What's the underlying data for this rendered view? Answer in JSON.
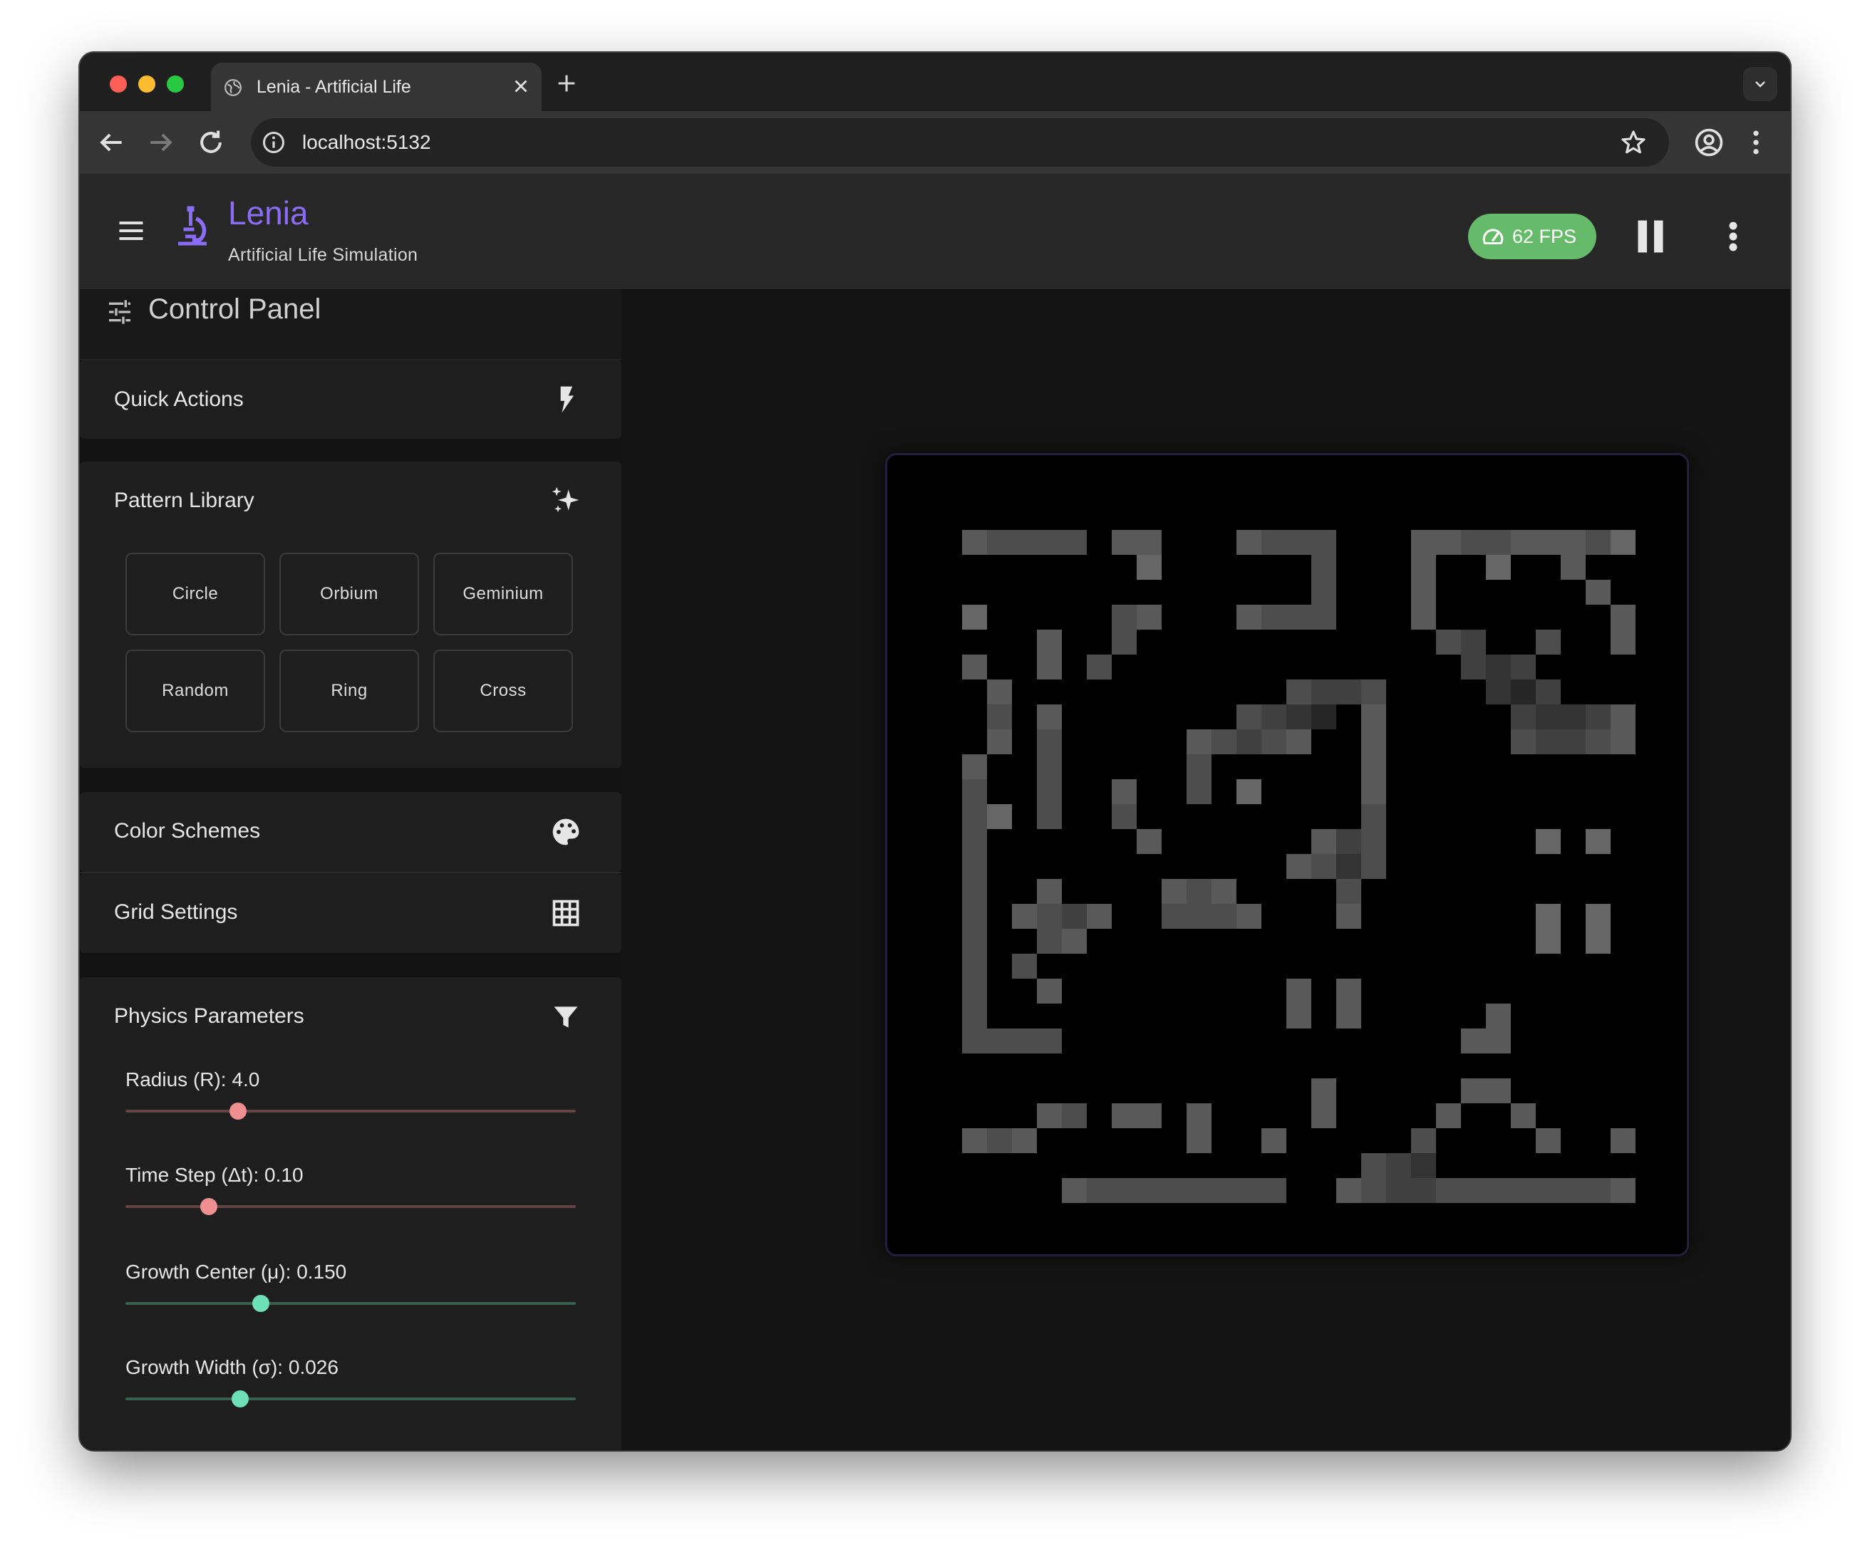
{
  "browser": {
    "tab_title": "Lenia - Artificial Life",
    "url": "localhost:5132"
  },
  "app": {
    "title": "Lenia",
    "subtitle": "Artificial Life Simulation",
    "fps_label": "62 FPS",
    "accent_color": "#8b6cf6",
    "fps_color": "#66bb6a"
  },
  "sidebar": {
    "title": "Control Panel",
    "sections": {
      "quick_actions": "Quick Actions",
      "pattern_library": "Pattern Library",
      "color_schemes": "Color Schemes",
      "grid_settings": "Grid Settings",
      "physics_parameters": "Physics Parameters"
    },
    "patterns": [
      "Circle",
      "Orbium",
      "Geminium",
      "Random",
      "Ring",
      "Cross"
    ],
    "params": [
      {
        "label": "Radius (R): 4.0",
        "fraction": 0.25,
        "color": "#ef8f8f"
      },
      {
        "label": "Time Step (Δt): 0.10",
        "fraction": 0.185,
        "color": "#ef8f8f"
      },
      {
        "label": "Growth Center (μ): 0.150",
        "fraction": 0.3,
        "color": "#6ee0b8"
      },
      {
        "label": "Growth Width (σ): 0.026",
        "fraction": 0.255,
        "color": "#6ee0b8"
      }
    ]
  },
  "simulation": {
    "grid_size": 27,
    "cells": [
      [
        3,
        3,
        0.35
      ],
      [
        4,
        3,
        0.3
      ],
      [
        5,
        3,
        0.3
      ],
      [
        6,
        3,
        0.3
      ],
      [
        7,
        3,
        0.3
      ],
      [
        9,
        3,
        0.35
      ],
      [
        10,
        3,
        0.35
      ],
      [
        14,
        3,
        0.35
      ],
      [
        15,
        3,
        0.3
      ],
      [
        16,
        3,
        0.3
      ],
      [
        17,
        3,
        0.3
      ],
      [
        21,
        3,
        0.35
      ],
      [
        22,
        3,
        0.35
      ],
      [
        23,
        3,
        0.3
      ],
      [
        24,
        3,
        0.3
      ],
      [
        25,
        3,
        0.35
      ],
      [
        26,
        3,
        0.35
      ],
      [
        27,
        3,
        0.35
      ],
      [
        28,
        3,
        0.3
      ],
      [
        29,
        3,
        0.4
      ],
      [
        10,
        4,
        0.4
      ],
      [
        17,
        4,
        0.3
      ],
      [
        21,
        4,
        0.35
      ],
      [
        24,
        4,
        0.4
      ],
      [
        27,
        4,
        0.35
      ],
      [
        17,
        5,
        0.3
      ],
      [
        21,
        5,
        0.35
      ],
      [
        28,
        5,
        0.35
      ],
      [
        3,
        6,
        0.4
      ],
      [
        9,
        6,
        0.3
      ],
      [
        10,
        6,
        0.35
      ],
      [
        14,
        6,
        0.35
      ],
      [
        15,
        6,
        0.3
      ],
      [
        16,
        6,
        0.3
      ],
      [
        17,
        6,
        0.3
      ],
      [
        21,
        6,
        0.35
      ],
      [
        29,
        6,
        0.35
      ],
      [
        6,
        7,
        0.35
      ],
      [
        9,
        7,
        0.3
      ],
      [
        22,
        7,
        0.3
      ],
      [
        23,
        7,
        0.25
      ],
      [
        26,
        7,
        0.3
      ],
      [
        29,
        7,
        0.35
      ],
      [
        3,
        8,
        0.35
      ],
      [
        6,
        8,
        0.35
      ],
      [
        8,
        8,
        0.3
      ],
      [
        23,
        8,
        0.25
      ],
      [
        24,
        8,
        0.2
      ],
      [
        25,
        8,
        0.25
      ],
      [
        4,
        9,
        0.35
      ],
      [
        16,
        9,
        0.3
      ],
      [
        17,
        9,
        0.25
      ],
      [
        18,
        9,
        0.25
      ],
      [
        19,
        9,
        0.3
      ],
      [
        24,
        9,
        0.2
      ],
      [
        25,
        9,
        0.15
      ],
      [
        26,
        9,
        0.25
      ],
      [
        4,
        10,
        0.3
      ],
      [
        6,
        10,
        0.35
      ],
      [
        14,
        10,
        0.3
      ],
      [
        15,
        10,
        0.25
      ],
      [
        16,
        10,
        0.2
      ],
      [
        17,
        10,
        0.15
      ],
      [
        19,
        10,
        0.35
      ],
      [
        25,
        10,
        0.25
      ],
      [
        26,
        10,
        0.2
      ],
      [
        27,
        10,
        0.2
      ],
      [
        28,
        10,
        0.25
      ],
      [
        29,
        10,
        0.35
      ],
      [
        4,
        11,
        0.35
      ],
      [
        6,
        11,
        0.3
      ],
      [
        12,
        11,
        0.35
      ],
      [
        13,
        11,
        0.3
      ],
      [
        14,
        11,
        0.25
      ],
      [
        15,
        11,
        0.3
      ],
      [
        16,
        11,
        0.35
      ],
      [
        19,
        11,
        0.35
      ],
      [
        25,
        11,
        0.3
      ],
      [
        26,
        11,
        0.25
      ],
      [
        27,
        11,
        0.25
      ],
      [
        28,
        11,
        0.3
      ],
      [
        29,
        11,
        0.35
      ],
      [
        3,
        12,
        0.35
      ],
      [
        6,
        12,
        0.3
      ],
      [
        12,
        12,
        0.3
      ],
      [
        19,
        12,
        0.35
      ],
      [
        3,
        13,
        0.3
      ],
      [
        6,
        13,
        0.3
      ],
      [
        9,
        13,
        0.35
      ],
      [
        12,
        13,
        0.3
      ],
      [
        14,
        13,
        0.4
      ],
      [
        19,
        13,
        0.35
      ],
      [
        3,
        14,
        0.3
      ],
      [
        4,
        14,
        0.4
      ],
      [
        6,
        14,
        0.3
      ],
      [
        9,
        14,
        0.3
      ],
      [
        19,
        14,
        0.3
      ],
      [
        3,
        15,
        0.3
      ],
      [
        10,
        15,
        0.35
      ],
      [
        17,
        15,
        0.35
      ],
      [
        18,
        15,
        0.25
      ],
      [
        19,
        15,
        0.3
      ],
      [
        26,
        15,
        0.4
      ],
      [
        28,
        15,
        0.4
      ],
      [
        3,
        16,
        0.3
      ],
      [
        16,
        16,
        0.35
      ],
      [
        17,
        16,
        0.3
      ],
      [
        18,
        16,
        0.2
      ],
      [
        19,
        16,
        0.3
      ],
      [
        3,
        17,
        0.3
      ],
      [
        6,
        17,
        0.35
      ],
      [
        11,
        17,
        0.35
      ],
      [
        12,
        17,
        0.3
      ],
      [
        13,
        17,
        0.35
      ],
      [
        18,
        17,
        0.3
      ],
      [
        3,
        18,
        0.3
      ],
      [
        5,
        18,
        0.35
      ],
      [
        6,
        18,
        0.3
      ],
      [
        7,
        18,
        0.25
      ],
      [
        8,
        18,
        0.35
      ],
      [
        11,
        18,
        0.3
      ],
      [
        12,
        18,
        0.3
      ],
      [
        13,
        18,
        0.3
      ],
      [
        14,
        18,
        0.35
      ],
      [
        18,
        18,
        0.35
      ],
      [
        26,
        18,
        0.4
      ],
      [
        28,
        18,
        0.4
      ],
      [
        3,
        19,
        0.3
      ],
      [
        6,
        19,
        0.3
      ],
      [
        7,
        19,
        0.35
      ],
      [
        26,
        19,
        0.4
      ],
      [
        28,
        19,
        0.4
      ],
      [
        3,
        20,
        0.3
      ],
      [
        5,
        20,
        0.3
      ],
      [
        3,
        21,
        0.3
      ],
      [
        6,
        21,
        0.35
      ],
      [
        16,
        21,
        0.35
      ],
      [
        18,
        21,
        0.35
      ],
      [
        3,
        22,
        0.3
      ],
      [
        16,
        22,
        0.35
      ],
      [
        18,
        22,
        0.35
      ],
      [
        24,
        22,
        0.35
      ],
      [
        3,
        23,
        0.3
      ],
      [
        4,
        23,
        0.3
      ],
      [
        5,
        23,
        0.3
      ],
      [
        6,
        23,
        0.3
      ],
      [
        23,
        23,
        0.35
      ],
      [
        24,
        23,
        0.35
      ],
      [
        17,
        25,
        0.35
      ],
      [
        23,
        25,
        0.35
      ],
      [
        24,
        25,
        0.35
      ],
      [
        6,
        26,
        0.35
      ],
      [
        7,
        26,
        0.3
      ],
      [
        9,
        26,
        0.35
      ],
      [
        10,
        26,
        0.35
      ],
      [
        12,
        26,
        0.35
      ],
      [
        17,
        26,
        0.35
      ],
      [
        22,
        26,
        0.35
      ],
      [
        25,
        26,
        0.35
      ],
      [
        3,
        27,
        0.35
      ],
      [
        4,
        27,
        0.3
      ],
      [
        5,
        27,
        0.35
      ],
      [
        12,
        27,
        0.35
      ],
      [
        15,
        27,
        0.35
      ],
      [
        21,
        27,
        0.3
      ],
      [
        26,
        27,
        0.35
      ],
      [
        29,
        27,
        0.35
      ],
      [
        19,
        28,
        0.3
      ],
      [
        20,
        28,
        0.25
      ],
      [
        21,
        28,
        0.2
      ],
      [
        7,
        29,
        0.35
      ],
      [
        8,
        29,
        0.3
      ],
      [
        9,
        29,
        0.3
      ],
      [
        10,
        29,
        0.3
      ],
      [
        11,
        29,
        0.3
      ],
      [
        12,
        29,
        0.3
      ],
      [
        13,
        29,
        0.3
      ],
      [
        14,
        29,
        0.3
      ],
      [
        15,
        29,
        0.3
      ],
      [
        18,
        29,
        0.35
      ],
      [
        19,
        29,
        0.3
      ],
      [
        20,
        29,
        0.25
      ],
      [
        21,
        29,
        0.25
      ],
      [
        22,
        29,
        0.3
      ],
      [
        23,
        29,
        0.3
      ],
      [
        24,
        29,
        0.3
      ],
      [
        25,
        29,
        0.3
      ],
      [
        26,
        29,
        0.3
      ],
      [
        27,
        29,
        0.3
      ],
      [
        28,
        29,
        0.3
      ],
      [
        29,
        29,
        0.35
      ]
    ]
  }
}
